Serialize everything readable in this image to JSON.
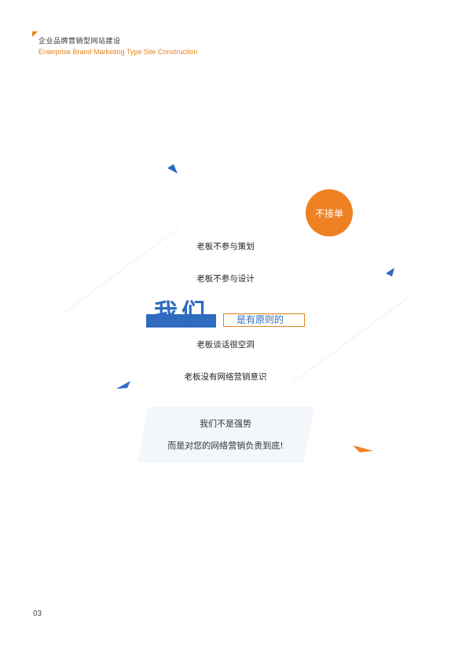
{
  "header": {
    "title_cn": "企业品牌营销型网站建设",
    "title_en": "Enterprise Brand Marketing Type Site Construction"
  },
  "badge": {
    "label": "不接单"
  },
  "statements": [
    "老板不参与策划",
    "老板不参与设计",
    "老板谈话很空洞",
    "老板没有网络营销意识"
  ],
  "highlight": {
    "we": "我们",
    "principle": "是有原则的"
  },
  "panel": {
    "line1": "我们不是强势",
    "line2": "而是对您的网络营销负责到底!"
  },
  "footer": {
    "page_number": "03"
  },
  "colors": {
    "accent_orange": "#ee8122",
    "accent_blue": "#2f6bbf",
    "panel_bg": "#f3f7fb"
  }
}
